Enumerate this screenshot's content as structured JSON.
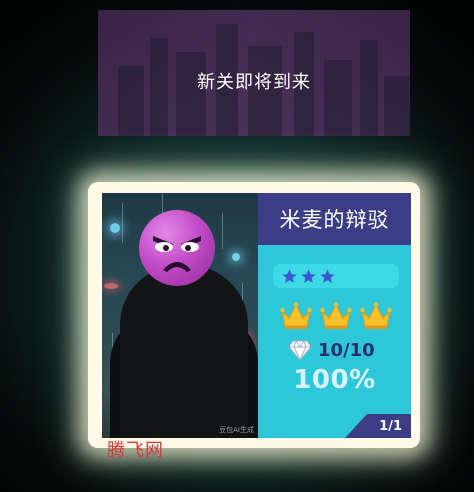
{
  "upcoming_level": {
    "text": "新关即将到来"
  },
  "level_card": {
    "title": "米麦的辩驳",
    "difficulty_stars": 3,
    "crowns_earned": 3,
    "gems": "10/10",
    "completion": "100%",
    "page_indicator": "1/1",
    "photo_caption": "豆包AI生成"
  },
  "watermark": {
    "text": "腾飞网"
  },
  "colors": {
    "title_bar": "#3b3d87",
    "card_bg": "#2cc7d8",
    "crown": "#f7c12b",
    "star": "#3a5bd0",
    "emoji": "#c24cc8"
  },
  "icons": [
    "star-icon",
    "crown-icon",
    "diamond-icon",
    "angry-face-icon"
  ]
}
